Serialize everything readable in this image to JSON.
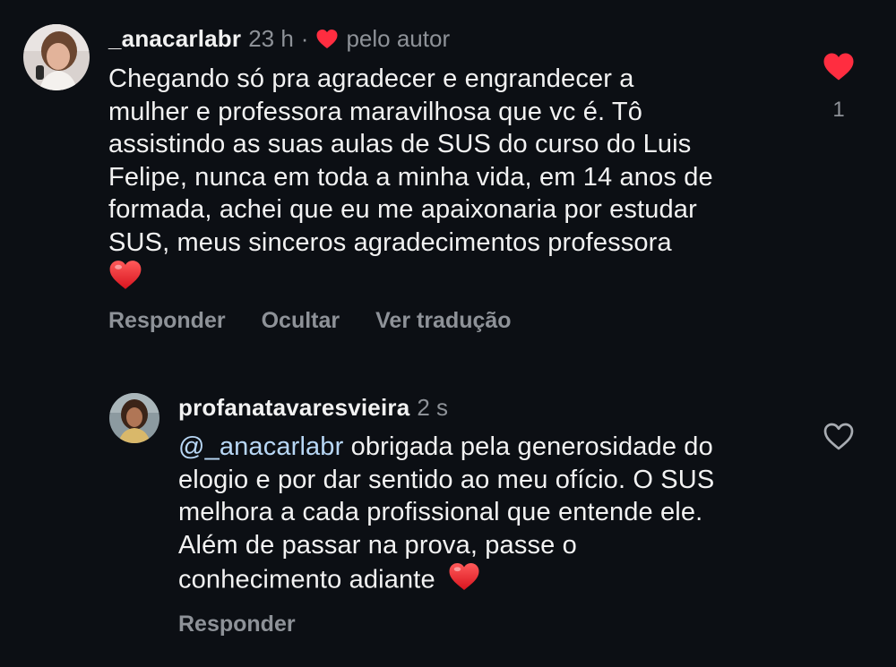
{
  "colors": {
    "background": "#0c0f14",
    "text": "#f2f2f2",
    "muted": "#8e9298",
    "heart_red": "#ff2d40",
    "mention": "#b8d7f5"
  },
  "comments": [
    {
      "username": "_anacarlabr",
      "time": "23 h",
      "separator": "·",
      "author_like_label": "pelo autor",
      "author_like_icon": "heart-icon",
      "text_lines": [
        "Chegando só pra agradecer e engrandecer a",
        "mulher e professora maravilhosa que vc é. Tô",
        "assistindo as suas aulas de SUS do curso do Luis",
        "Felipe, nunca em toda a minha vida, em 14 anos de",
        "formada, achei que eu me apaixonaria por estudar",
        "SUS, meus sinceros agradecimentos professora"
      ],
      "emoji": "heart-emoji",
      "actions": [
        "Responder",
        "Ocultar",
        "Ver tradução"
      ],
      "like_icon": "heart-filled-icon",
      "like_count": "1"
    },
    {
      "username": "profanatavaresvieira",
      "time": "2 s",
      "mention": "@_anacarlabr",
      "text_lines": [
        "obrigada pela generosidade do",
        "elogio e por dar sentido ao meu ofício. O SUS",
        "melhora a cada profissional que entende ele.",
        "Além de passar na prova, passe o",
        "conhecimento adiante"
      ],
      "emoji": "heart-emoji",
      "actions": [
        "Responder"
      ],
      "like_icon": "heart-outline-icon"
    }
  ]
}
